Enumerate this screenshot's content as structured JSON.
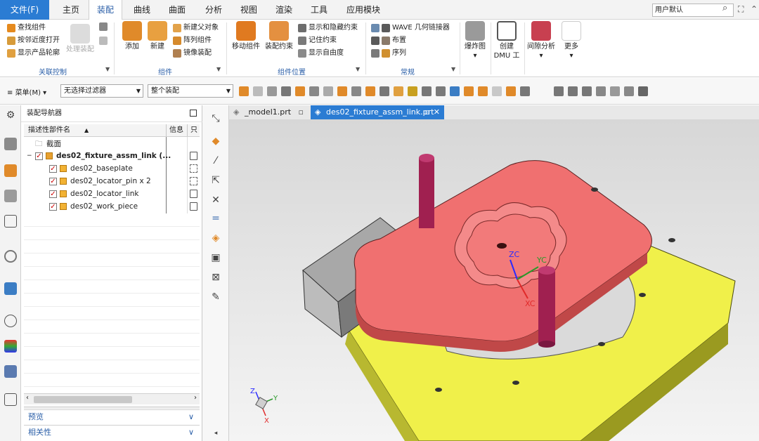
{
  "menubar": {
    "file": "文件(F)",
    "tabs": [
      "主页",
      "装配",
      "曲线",
      "曲面",
      "分析",
      "视图",
      "渲染",
      "工具",
      "应用模块"
    ],
    "search_value": "用户默认"
  },
  "ribbon": {
    "groups": {
      "related_control": "关联控制",
      "component": "组件",
      "component_position": "组件位置",
      "general": "常规"
    },
    "related": {
      "find_component": "查找组件",
      "open_by_proximity": "按邻近度打开",
      "show_product_outline": "显示产品轮廓",
      "process_assembly": "处理装配"
    },
    "component": {
      "add": "添加",
      "new": "新建",
      "new_parent": "新建父对象",
      "array_component": "阵列组件",
      "mirror_assembly": "镜像装配"
    },
    "position": {
      "move_component": "移动组件",
      "assembly_constraint": "装配约束",
      "show_hide_constraint": "显示和隐藏约束",
      "remember_constraint": "记住约束",
      "show_dof": "显示自由度"
    },
    "general": {
      "wave_linker": "WAVE 几何链接器",
      "layout": "布置",
      "sequence": "序列"
    },
    "right": {
      "exploded_view": "爆炸图",
      "create_dmu_line1": "创建",
      "create_dmu_line2": "DMU 工",
      "interference": "间隙分析",
      "more": "更多"
    }
  },
  "toolbar": {
    "menu": "菜单(M)",
    "filter": "无选择过滤器",
    "scope": "整个装配"
  },
  "navigator": {
    "title": "装配导航器",
    "col_name": "描述性部件名",
    "col_info": "信息",
    "col_extra": "只",
    "section_node": "截面",
    "root": "des02_fixture_assm_link (...",
    "children": [
      "des02_baseplate",
      "des02_locator_pin x 2",
      "des02_locator_link",
      "des02_work_piece"
    ],
    "preview": "预览",
    "dependency": "相关性"
  },
  "tabs": {
    "tab1": "_model1.prt",
    "tab2": "des02_fixture_assm_link.prt"
  },
  "viewport": {
    "wcs_z": "ZC",
    "wcs_y": "YC",
    "wcs_x": "XC",
    "triad_z": "Z",
    "triad_y": "Y",
    "triad_x": "X"
  }
}
